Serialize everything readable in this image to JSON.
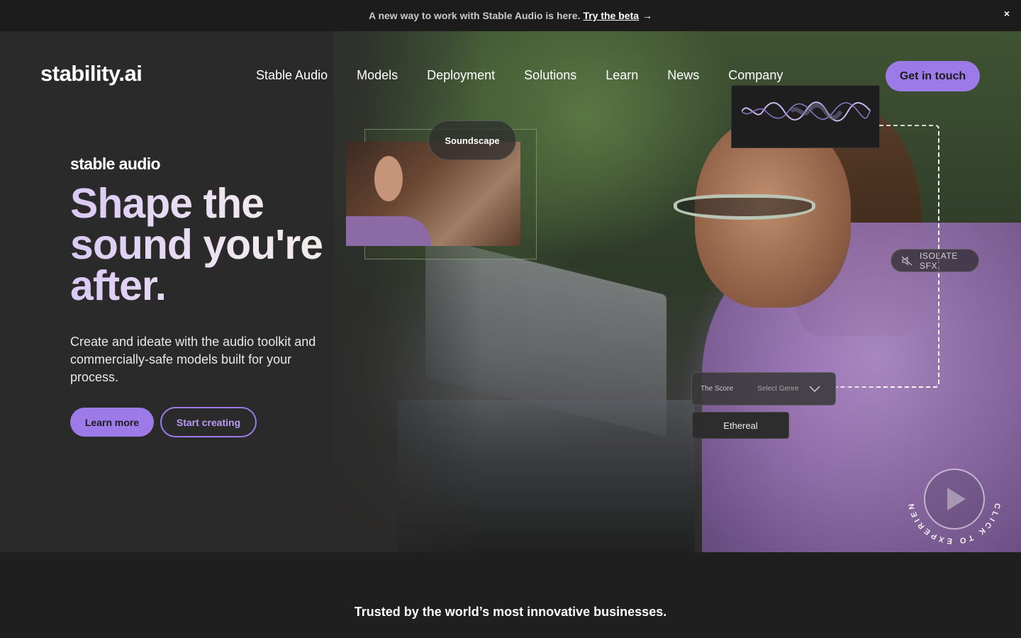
{
  "banner": {
    "text": "A new way to work with Stable Audio is here.",
    "link_label": "Try the beta",
    "arrow": "→",
    "close": "×"
  },
  "header": {
    "logo": "stability.ai",
    "nav": [
      "Stable Audio",
      "Models",
      "Deployment",
      "Solutions",
      "Learn",
      "News",
      "Company"
    ],
    "cta": "Get in touch"
  },
  "hero": {
    "brand": "stable audio",
    "headline": "Shape the sound you're after.",
    "description": "Create and ideate with the audio toolkit and commercially-safe models built for your process.",
    "primary_button": "Learn more",
    "secondary_button": "Start creating",
    "soundscape_label": "Soundscape",
    "isolate_label": "ISOLATE SFX",
    "score_label": "The Score",
    "genre_placeholder": "Select Genre",
    "ethereal_label": "Ethereal",
    "play_ring_text": "CLICK TO EXPERIENCE SOUND",
    "accent_color": "#9c7be8"
  },
  "trusted": {
    "title": "Trusted by the world’s most innovative businesses."
  }
}
